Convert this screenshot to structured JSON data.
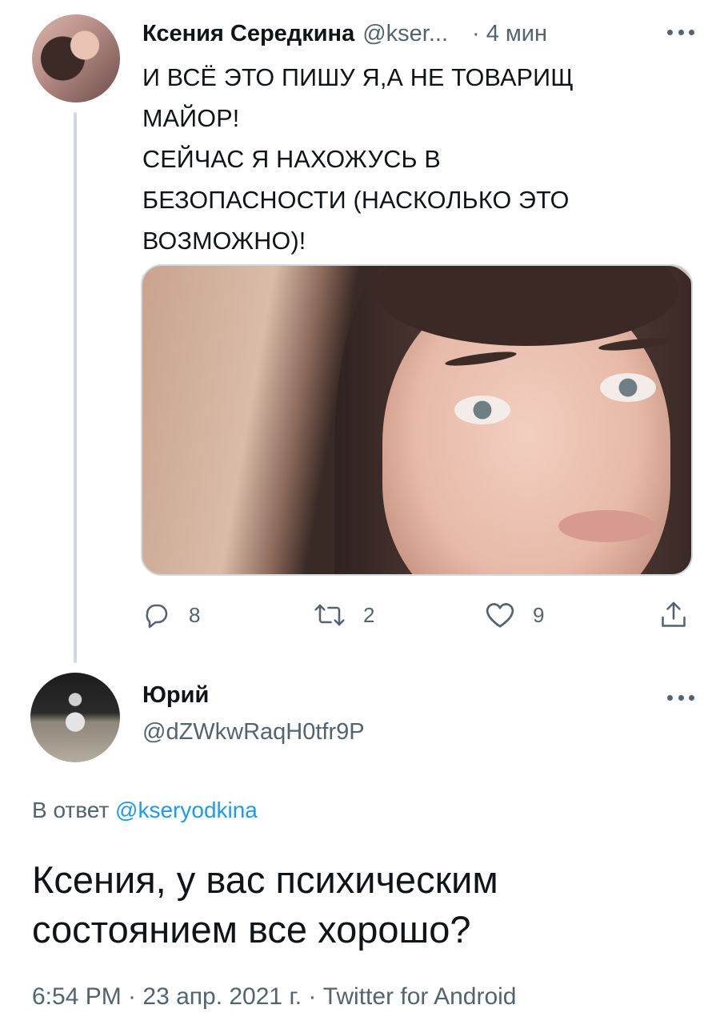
{
  "parent_tweet": {
    "author_name": "Ксения Середкина",
    "author_handle": "@kser...",
    "separator": "·",
    "time_ago": "4 мин",
    "text_lines": [
      "И ВСЁ ЭТО ПИШУ Я,А НЕ ТОВАРИЩ",
      "МАЙОР!",
      "СЕЙЧАС Я НАХОЖУСЬ В",
      "БЕЗОПАСНОСТИ (НАСКОЛЬКО ЭТО",
      "ВОЗМОЖНО)!"
    ],
    "actions": {
      "replies": "8",
      "retweets": "2",
      "likes": "9"
    }
  },
  "reply_tweet": {
    "author_name": "Юрий",
    "author_handle": "@dZWkwRaqH0tfr9P",
    "reply_prefix": "В ответ",
    "reply_mention": "@kseryodkina",
    "text_lines": [
      "Ксения, у вас психическим",
      "состоянием все хорошо?"
    ],
    "meta": "6:54 PM · 23 апр. 2021 г. · Twitter for Android"
  },
  "colors": {
    "text_primary": "#0f1419",
    "text_secondary": "#536471",
    "link": "#1d9bf0",
    "thread_line": "#cfd9de"
  },
  "icons": {
    "reply": "reply-icon",
    "retweet": "retweet-icon",
    "like": "heart-icon",
    "share": "share-icon",
    "more": "more-options-icon"
  }
}
